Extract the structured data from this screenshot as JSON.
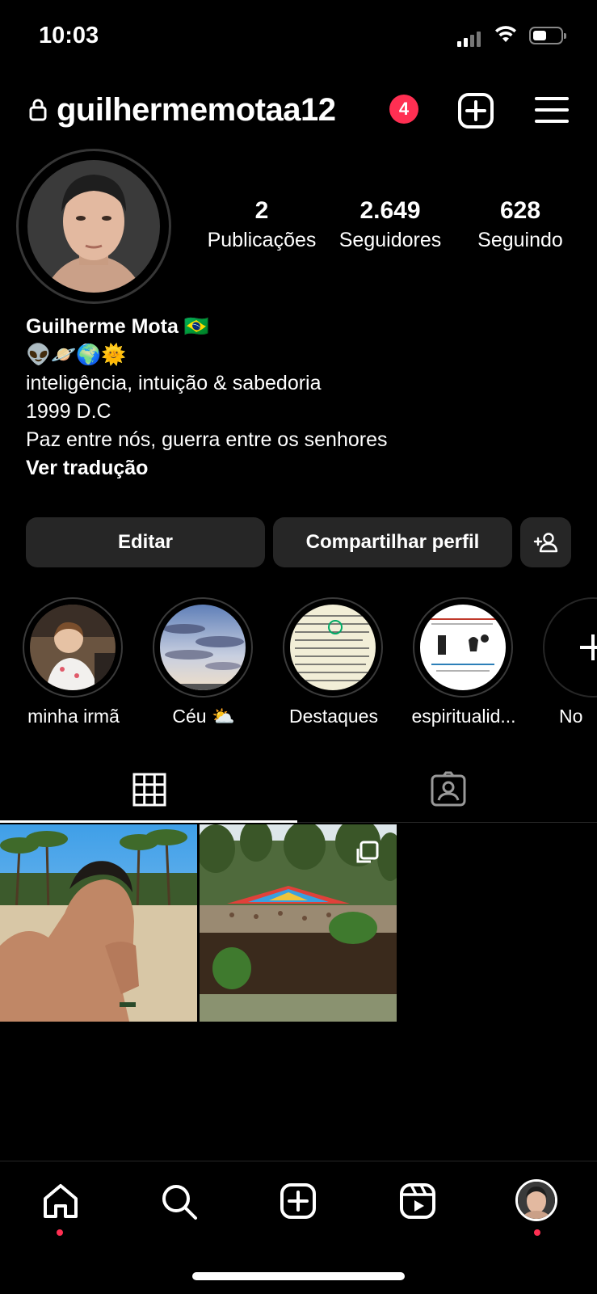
{
  "status_bar": {
    "time": "10:03"
  },
  "header": {
    "username": "guilhermemotaa12",
    "notification_count": "4"
  },
  "stats": [
    {
      "value": "2",
      "label": "Publicações"
    },
    {
      "value": "2.649",
      "label": "Seguidores"
    },
    {
      "value": "628",
      "label": "Seguindo"
    }
  ],
  "bio": {
    "name": "Guilherme Mota 🇧🇷",
    "emojis": "👽🪐🌍🌞",
    "line1": "inteligência, intuição & sabedoria",
    "line2": "1999 D.C",
    "line3": "Paz entre nós, guerra entre os senhores",
    "translate": "Ver tradução"
  },
  "buttons": {
    "edit": "Editar",
    "share": "Compartilhar perfil"
  },
  "highlights": [
    {
      "label": "minha irmã"
    },
    {
      "label": "Céu ⛅"
    },
    {
      "label": "Destaques"
    },
    {
      "label": "espiritualid..."
    },
    {
      "label": "No"
    }
  ],
  "colors": {
    "badge": "#ff2f52",
    "button_bg": "#262626",
    "background": "#000000"
  }
}
